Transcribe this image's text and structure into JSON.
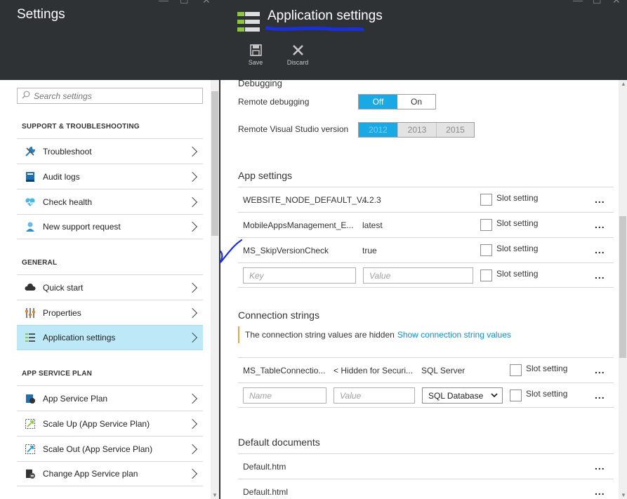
{
  "left_blade": {
    "title": "Settings",
    "search_placeholder": "Search settings",
    "sections": [
      {
        "label": "SUPPORT & TROUBLESHOOTING"
      },
      {
        "label": "GENERAL"
      },
      {
        "label": "APP SERVICE PLAN"
      }
    ],
    "items": [
      {
        "label": "Troubleshoot",
        "icon": "wrench-icon"
      },
      {
        "label": "Audit logs",
        "icon": "book-icon"
      },
      {
        "label": "Check health",
        "icon": "heart-icon"
      },
      {
        "label": "New support request",
        "icon": "support-person-icon"
      },
      {
        "label": "Quick start",
        "icon": "cloud-icon"
      },
      {
        "label": "Properties",
        "icon": "sliders-icon"
      },
      {
        "label": "Application settings",
        "icon": "list-settings-icon",
        "selected": true
      },
      {
        "label": "App Service Plan",
        "icon": "service-plan-icon"
      },
      {
        "label": "Scale Up (App Service Plan)",
        "icon": "scale-up-icon"
      },
      {
        "label": "Scale Out (App Service Plan)",
        "icon": "scale-out-icon"
      },
      {
        "label": "Change App Service plan",
        "icon": "change-plan-icon"
      }
    ]
  },
  "right_blade": {
    "title": "Application settings",
    "toolbar": {
      "save_label": "Save",
      "discard_label": "Discard"
    },
    "debugging": {
      "heading": "Debugging",
      "remote_debugging_label": "Remote debugging",
      "remote_debugging_options": [
        "Off",
        "On"
      ],
      "remote_debugging_selected": "Off",
      "vs_version_label": "Remote Visual Studio version",
      "vs_version_options": [
        "2012",
        "2013",
        "2015"
      ],
      "vs_version_selected": "2012"
    },
    "app_settings": {
      "heading": "App settings",
      "slot_label": "Slot setting",
      "rows": [
        {
          "key": "WEBSITE_NODE_DEFAULT_V...",
          "value": "4.2.3"
        },
        {
          "key": "MobileAppsManagement_E...",
          "value": "latest"
        },
        {
          "key": "MS_SkipVersionCheck",
          "value": "true"
        }
      ],
      "key_placeholder": "Key",
      "value_placeholder": "Value"
    },
    "connection_strings": {
      "heading": "Connection strings",
      "hidden_notice": "The connection string values are hidden",
      "show_link": "Show connection string values",
      "rows": [
        {
          "name": "MS_TableConnectio...",
          "value": "< Hidden for Securi...",
          "type": "SQL Server"
        }
      ],
      "name_placeholder": "Name",
      "value_placeholder": "Value",
      "type_selected": "SQL Database"
    },
    "default_documents": {
      "heading": "Default documents",
      "rows": [
        "Default.htm",
        "Default.html"
      ]
    },
    "more_label": "..."
  }
}
